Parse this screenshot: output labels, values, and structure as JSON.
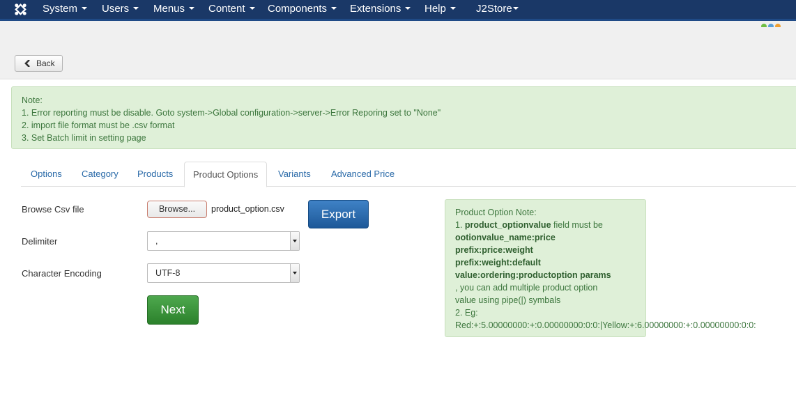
{
  "navbar": {
    "items": [
      {
        "label": "System"
      },
      {
        "label": "Users"
      },
      {
        "label": "Menus"
      },
      {
        "label": "Content"
      },
      {
        "label": "Components"
      },
      {
        "label": "Extensions"
      },
      {
        "label": "Help"
      },
      {
        "label": "J2Store"
      }
    ]
  },
  "toolbar": {
    "back_label": "Back"
  },
  "note": {
    "title": "Note:",
    "lines": [
      "1. Error reporting must be disable. Goto system->Global configuration->server->Error Reporing set to \"None\"",
      "2. import file format must be .csv format",
      "3. Set Batch limit in setting page"
    ]
  },
  "tabs": [
    {
      "label": "Options"
    },
    {
      "label": "Category"
    },
    {
      "label": "Products"
    },
    {
      "label": "Product Options"
    },
    {
      "label": "Variants"
    },
    {
      "label": "Advanced Price"
    }
  ],
  "form": {
    "browse_label": "Browse Csv file",
    "browse_button": "Browse...",
    "file_name": "product_option.csv",
    "export_button": "Export",
    "delimiter_label": "Delimiter",
    "delimiter_value": ",",
    "encoding_label": "Character Encoding",
    "encoding_value": "UTF-8",
    "next_button": "Next"
  },
  "po_note": {
    "title": "Product Option Note:",
    "line1_prefix": "1. ",
    "line1_bold": "product_optionvalue",
    "line1_suffix": " field must be",
    "bold_lines": [
      "ootionvalue_name:price",
      "prefix:price:weight",
      "prefix:weight:default",
      "value:ordering:productoption params"
    ],
    "line_after_1": ", you can add multiple product option",
    "line_after_2": "value using pipe(|) symbals",
    "eg_label": "2. Eg:",
    "eg_value": "Red:+:5.00000000:+:0.00000000:0:0:|Yellow:+:6.00000000:+:0.00000000:0:0:"
  }
}
